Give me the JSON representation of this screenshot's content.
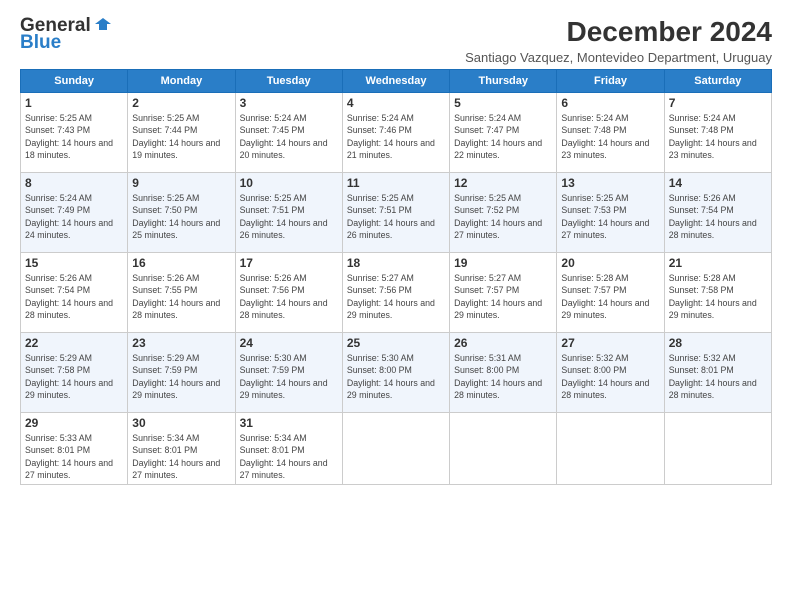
{
  "header": {
    "logo_general": "General",
    "logo_blue": "Blue",
    "month_title": "December 2024",
    "subtitle": "Santiago Vazquez, Montevideo Department, Uruguay"
  },
  "days_of_week": [
    "Sunday",
    "Monday",
    "Tuesday",
    "Wednesday",
    "Thursday",
    "Friday",
    "Saturday"
  ],
  "weeks": [
    [
      {
        "day": "1",
        "sunrise": "Sunrise: 5:25 AM",
        "sunset": "Sunset: 7:43 PM",
        "daylight": "Daylight: 14 hours and 18 minutes."
      },
      {
        "day": "2",
        "sunrise": "Sunrise: 5:25 AM",
        "sunset": "Sunset: 7:44 PM",
        "daylight": "Daylight: 14 hours and 19 minutes."
      },
      {
        "day": "3",
        "sunrise": "Sunrise: 5:24 AM",
        "sunset": "Sunset: 7:45 PM",
        "daylight": "Daylight: 14 hours and 20 minutes."
      },
      {
        "day": "4",
        "sunrise": "Sunrise: 5:24 AM",
        "sunset": "Sunset: 7:46 PM",
        "daylight": "Daylight: 14 hours and 21 minutes."
      },
      {
        "day": "5",
        "sunrise": "Sunrise: 5:24 AM",
        "sunset": "Sunset: 7:47 PM",
        "daylight": "Daylight: 14 hours and 22 minutes."
      },
      {
        "day": "6",
        "sunrise": "Sunrise: 5:24 AM",
        "sunset": "Sunset: 7:48 PM",
        "daylight": "Daylight: 14 hours and 23 minutes."
      },
      {
        "day": "7",
        "sunrise": "Sunrise: 5:24 AM",
        "sunset": "Sunset: 7:48 PM",
        "daylight": "Daylight: 14 hours and 23 minutes."
      }
    ],
    [
      {
        "day": "8",
        "sunrise": "Sunrise: 5:24 AM",
        "sunset": "Sunset: 7:49 PM",
        "daylight": "Daylight: 14 hours and 24 minutes."
      },
      {
        "day": "9",
        "sunrise": "Sunrise: 5:25 AM",
        "sunset": "Sunset: 7:50 PM",
        "daylight": "Daylight: 14 hours and 25 minutes."
      },
      {
        "day": "10",
        "sunrise": "Sunrise: 5:25 AM",
        "sunset": "Sunset: 7:51 PM",
        "daylight": "Daylight: 14 hours and 26 minutes."
      },
      {
        "day": "11",
        "sunrise": "Sunrise: 5:25 AM",
        "sunset": "Sunset: 7:51 PM",
        "daylight": "Daylight: 14 hours and 26 minutes."
      },
      {
        "day": "12",
        "sunrise": "Sunrise: 5:25 AM",
        "sunset": "Sunset: 7:52 PM",
        "daylight": "Daylight: 14 hours and 27 minutes."
      },
      {
        "day": "13",
        "sunrise": "Sunrise: 5:25 AM",
        "sunset": "Sunset: 7:53 PM",
        "daylight": "Daylight: 14 hours and 27 minutes."
      },
      {
        "day": "14",
        "sunrise": "Sunrise: 5:26 AM",
        "sunset": "Sunset: 7:54 PM",
        "daylight": "Daylight: 14 hours and 28 minutes."
      }
    ],
    [
      {
        "day": "15",
        "sunrise": "Sunrise: 5:26 AM",
        "sunset": "Sunset: 7:54 PM",
        "daylight": "Daylight: 14 hours and 28 minutes."
      },
      {
        "day": "16",
        "sunrise": "Sunrise: 5:26 AM",
        "sunset": "Sunset: 7:55 PM",
        "daylight": "Daylight: 14 hours and 28 minutes."
      },
      {
        "day": "17",
        "sunrise": "Sunrise: 5:26 AM",
        "sunset": "Sunset: 7:56 PM",
        "daylight": "Daylight: 14 hours and 28 minutes."
      },
      {
        "day": "18",
        "sunrise": "Sunrise: 5:27 AM",
        "sunset": "Sunset: 7:56 PM",
        "daylight": "Daylight: 14 hours and 29 minutes."
      },
      {
        "day": "19",
        "sunrise": "Sunrise: 5:27 AM",
        "sunset": "Sunset: 7:57 PM",
        "daylight": "Daylight: 14 hours and 29 minutes."
      },
      {
        "day": "20",
        "sunrise": "Sunrise: 5:28 AM",
        "sunset": "Sunset: 7:57 PM",
        "daylight": "Daylight: 14 hours and 29 minutes."
      },
      {
        "day": "21",
        "sunrise": "Sunrise: 5:28 AM",
        "sunset": "Sunset: 7:58 PM",
        "daylight": "Daylight: 14 hours and 29 minutes."
      }
    ],
    [
      {
        "day": "22",
        "sunrise": "Sunrise: 5:29 AM",
        "sunset": "Sunset: 7:58 PM",
        "daylight": "Daylight: 14 hours and 29 minutes."
      },
      {
        "day": "23",
        "sunrise": "Sunrise: 5:29 AM",
        "sunset": "Sunset: 7:59 PM",
        "daylight": "Daylight: 14 hours and 29 minutes."
      },
      {
        "day": "24",
        "sunrise": "Sunrise: 5:30 AM",
        "sunset": "Sunset: 7:59 PM",
        "daylight": "Daylight: 14 hours and 29 minutes."
      },
      {
        "day": "25",
        "sunrise": "Sunrise: 5:30 AM",
        "sunset": "Sunset: 8:00 PM",
        "daylight": "Daylight: 14 hours and 29 minutes."
      },
      {
        "day": "26",
        "sunrise": "Sunrise: 5:31 AM",
        "sunset": "Sunset: 8:00 PM",
        "daylight": "Daylight: 14 hours and 28 minutes."
      },
      {
        "day": "27",
        "sunrise": "Sunrise: 5:32 AM",
        "sunset": "Sunset: 8:00 PM",
        "daylight": "Daylight: 14 hours and 28 minutes."
      },
      {
        "day": "28",
        "sunrise": "Sunrise: 5:32 AM",
        "sunset": "Sunset: 8:01 PM",
        "daylight": "Daylight: 14 hours and 28 minutes."
      }
    ],
    [
      {
        "day": "29",
        "sunrise": "Sunrise: 5:33 AM",
        "sunset": "Sunset: 8:01 PM",
        "daylight": "Daylight: 14 hours and 27 minutes."
      },
      {
        "day": "30",
        "sunrise": "Sunrise: 5:34 AM",
        "sunset": "Sunset: 8:01 PM",
        "daylight": "Daylight: 14 hours and 27 minutes."
      },
      {
        "day": "31",
        "sunrise": "Sunrise: 5:34 AM",
        "sunset": "Sunset: 8:01 PM",
        "daylight": "Daylight: 14 hours and 27 minutes."
      },
      null,
      null,
      null,
      null
    ]
  ]
}
